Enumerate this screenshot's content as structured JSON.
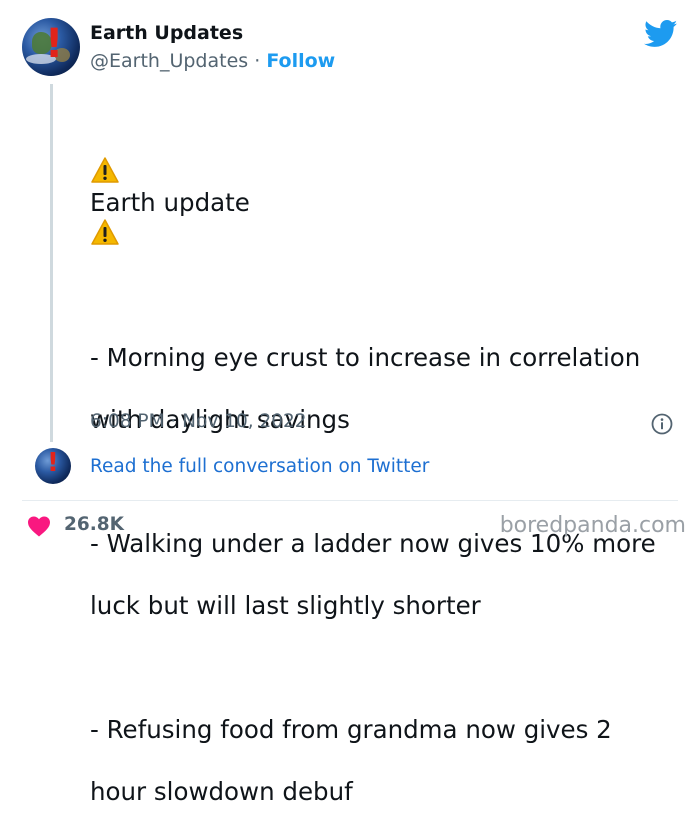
{
  "author": {
    "name": "Earth Updates",
    "handle": "@Earth_Updates",
    "separator": "·",
    "follow_label": "Follow"
  },
  "tweet": {
    "heading": "Earth update",
    "lines": [
      "- Morning eye crust to increase in correlation",
      "with daylight savings",
      "- Walking under a ladder now gives 10% more",
      "luck but will last slightly shorter",
      "- Refusing food from grandma now gives 2",
      "hour slowdown debuf"
    ],
    "timestamp": "6:08 PM · Nov 10, 2022"
  },
  "conversation": {
    "link_label": "Read the full conversation on Twitter"
  },
  "stats": {
    "likes": "26.8K"
  },
  "watermark": "boredpanda.com",
  "colors": {
    "link": "#1d9bf0",
    "heart": "#f91880",
    "warning": "#f5b800"
  },
  "icons": [
    "twitter-bird-icon",
    "warning-icon",
    "info-icon",
    "heart-icon"
  ]
}
